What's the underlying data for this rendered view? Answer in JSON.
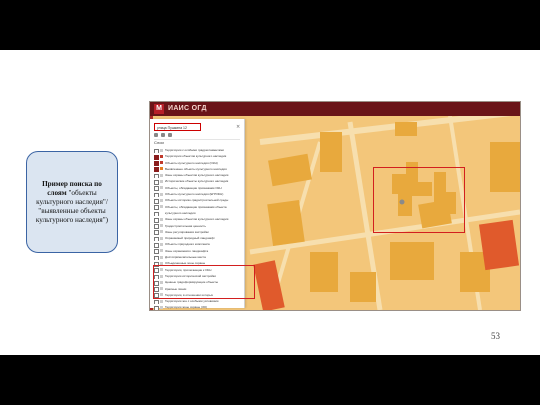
{
  "callout": {
    "line1": "Пример поиска по",
    "line2": "слоям",
    "quote1": " \"объекты",
    "line3": "культурного наследия\"/",
    "line4": "\"выявленные объекты",
    "line5": "культурного наследия\")"
  },
  "page_number": "53",
  "app": {
    "logo_letter": "М",
    "title": "ИАИС ОГД",
    "search_value": "улица Пушкина 12",
    "layers_header": "Слои",
    "layers": [
      {
        "label": "Территории с особыми градрегламентами",
        "checked": false,
        "color": "#cccccc"
      },
      {
        "label": "Территории объектов культурного наследия",
        "checked": true,
        "color": "#c0392b"
      },
      {
        "label": "Объекты культурного наследия (ОКН)",
        "checked": true,
        "color": "#c0392b"
      },
      {
        "label": "Выявленные объекты культурного наследия",
        "checked": true,
        "color": "#e67e22"
      },
      {
        "label": "Зоны охраны объектов культурного наследия",
        "checked": false,
        "color": "#cccccc"
      },
      {
        "label": "Исторические объекты культурного наследия",
        "checked": false,
        "color": "#cccccc"
      },
      {
        "label": "Объекты, обладающие признаками ОКН",
        "checked": false,
        "color": "#cccccc"
      },
      {
        "label": "Объекты культурного наследия (ЕГРОКН)",
        "checked": false,
        "color": "#cccccc"
      },
      {
        "label": "Объекты историко-градостроительной среды",
        "checked": false,
        "color": "#cccccc"
      },
      {
        "label": "Объекты, обладающие признаками объекта",
        "checked": false,
        "color": "#cccccc"
      },
      {
        "label": "культурного наследия",
        "checked": false,
        "color": "#ffffff"
      },
      {
        "label": "Зоны охраны объектов культурного наследия",
        "checked": false,
        "color": "#cccccc"
      },
      {
        "label": "Градостроительная ценность",
        "checked": false,
        "color": "#cccccc"
      },
      {
        "label": "Зоны регулирования застройки",
        "checked": false,
        "color": "#cccccc"
      },
      {
        "label": "Охраняемый природный ландшафт",
        "checked": false,
        "color": "#cccccc"
      },
      {
        "label": "Объекты природного комплекса",
        "checked": false,
        "color": "#cccccc"
      },
      {
        "label": "Зоны охраняемого ландшафта",
        "checked": false,
        "color": "#cccccc"
      },
      {
        "label": "Достопримечательные места",
        "checked": false,
        "color": "#cccccc"
      },
      {
        "label": "Объединенные зоны охраны",
        "checked": false,
        "color": "#cccccc"
      },
      {
        "label": "Территории, прилегающие к ОКН",
        "checked": false,
        "color": "#cccccc"
      },
      {
        "label": "Территории исторической застройки",
        "checked": false,
        "color": "#cccccc"
      },
      {
        "label": "Ценные градоформирующие объекты",
        "checked": false,
        "color": "#cccccc"
      },
      {
        "label": "Красные линии",
        "checked": false,
        "color": "#cccccc"
      },
      {
        "label": "Территории, в отношении которых",
        "checked": false,
        "color": "#cccccc"
      },
      {
        "label": "Территории зон с особыми условиями",
        "checked": false,
        "color": "#cccccc"
      },
      {
        "label": "Территории зоны охраны (ЗО)",
        "checked": false,
        "color": "#cccccc"
      },
      {
        "label": "Территории зоны охраны ОКН",
        "checked": false,
        "color": "#cccccc"
      },
      {
        "label": "Территории зоны охраны прочие",
        "checked": false,
        "color": "#cccccc"
      },
      {
        "label": "Территории зоны охраны ландшафта",
        "checked": false,
        "color": "#cccccc"
      },
      {
        "label": "Зоны регулирования",
        "checked": false,
        "color": "#cccccc"
      },
      {
        "label": "Границы",
        "checked": false,
        "color": "#cccccc"
      },
      {
        "label": "Кадастровые участки",
        "checked": false,
        "color": "#cccccc"
      },
      {
        "label": "Промышленные и производственные зоны",
        "checked": false,
        "color": "#cccccc"
      },
      {
        "label": "Зоны",
        "checked": false,
        "color": "#cccccc"
      }
    ]
  },
  "colors": {
    "map_base": "#f3c67a",
    "building": "#e8a93d",
    "highlight": "#d21f1f",
    "header": "#6a1418",
    "callout_fill": "#dbe5f1",
    "callout_border": "#3b64a4"
  }
}
